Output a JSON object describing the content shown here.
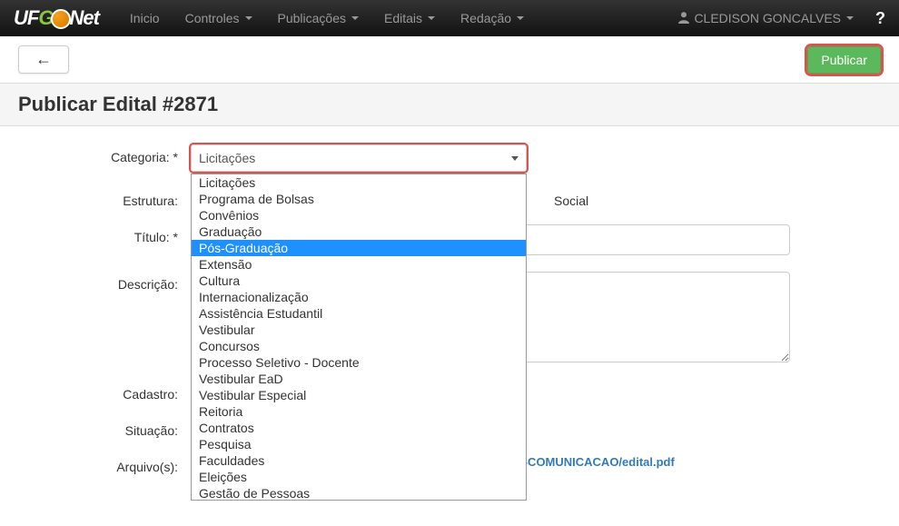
{
  "nav": {
    "logo_part1": "UF",
    "logo_part2": "G",
    "logo_part3": "Net",
    "items": [
      "Inicio",
      "Controles",
      "Publicações",
      "Editais",
      "Redação"
    ],
    "user": "CLEDISON GONCALVES",
    "help": "?"
  },
  "toolbar": {
    "back": "←",
    "publish": "Publicar"
  },
  "header": {
    "title": "Publicar Edital #2871"
  },
  "form": {
    "categoria_label": "Categoria: *",
    "categoria_value": "Licitações",
    "categoria_options": [
      "Licitações",
      "Programa de Bolsas",
      "Convênios",
      "Graduação",
      "Pós-Graduação",
      "Extensão",
      "Cultura",
      "Internacionalização",
      "Assistência Estudantil",
      "Vestibular",
      "Concursos",
      "Processo Seletivo - Docente",
      "Vestibular EaD",
      "Vestibular Especial",
      "Reitoria",
      "Contratos",
      "Pesquisa",
      "Faculdades",
      "Eleições",
      "Gestão de Pessoas"
    ],
    "categoria_highlighted_index": 4,
    "estrutura_label": "Estrutura:",
    "estrutura_value": "Social",
    "titulo_label": "Título: *",
    "titulo_value": "",
    "descricao_label": "Descrição:",
    "descricao_value": "",
    "cadastro_label": "Cadastro:",
    "cadastro_value": "",
    "situacao_label": "Situação:",
    "situacao_value": "",
    "arquivos_label": "Arquivo(s):",
    "arquivo_link": "http://files.ufgd.edu.br/arquivos/editais/78/ASSESSORIA-COMUNICACAO/edital.pdf"
  }
}
